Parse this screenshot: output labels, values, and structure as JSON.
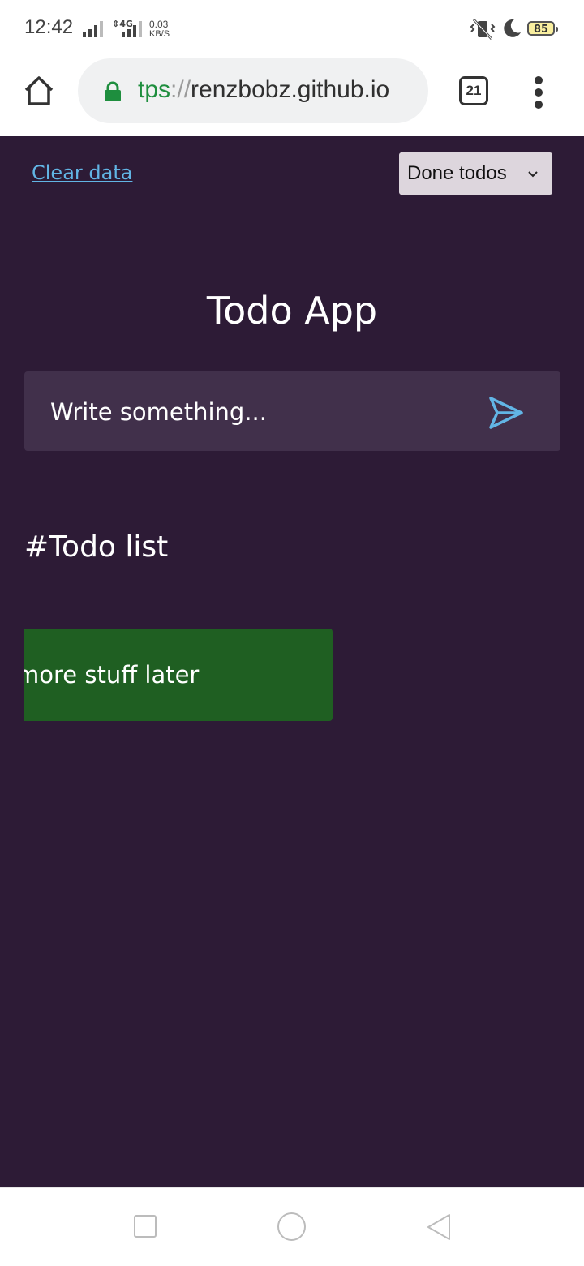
{
  "status_bar": {
    "time": "12:42",
    "network_type": "4G",
    "speed_value": "0.03",
    "speed_unit": "KB/S",
    "battery": "85"
  },
  "browser": {
    "url_scheme": "tps",
    "url_sep": "://",
    "url_host": "renzbobz.github.io",
    "tab_count": "21",
    "accent_color": "#1e8e3e"
  },
  "app": {
    "clear_link": "Clear data",
    "filter_selected": "Done todos",
    "title": "Todo App",
    "input_placeholder": "Write something...",
    "list_heading": "#Todo list",
    "todos": [
      {
        "text": "more stuff later",
        "done": true
      }
    ],
    "colors": {
      "background": "#2d1b36",
      "input_bg": "#41304b",
      "done_item": "#1f5f22",
      "link": "#62b5e5"
    }
  }
}
